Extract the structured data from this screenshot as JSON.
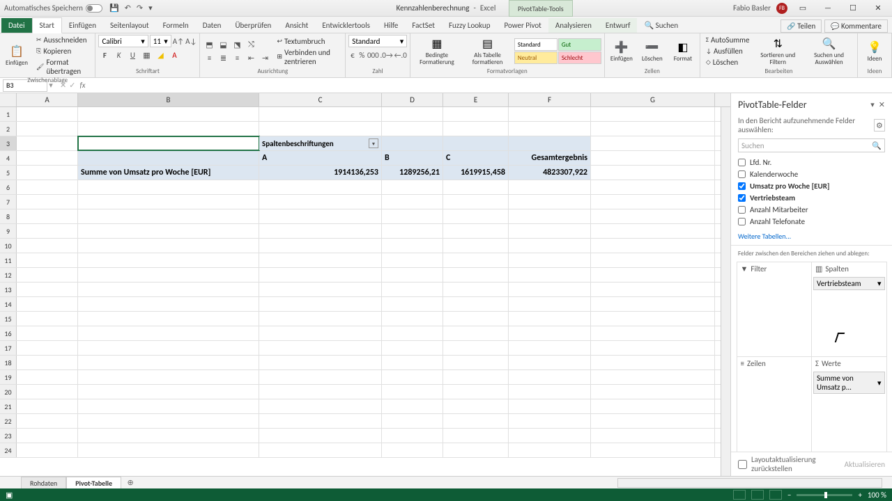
{
  "titlebar": {
    "autosave": "Automatisches Speichern",
    "docname": "Kennzahlenberechnung",
    "appname": "Excel",
    "tooltab": "PivotTable-Tools",
    "user": "Fabio Basler",
    "initials": "FB"
  },
  "tabs": {
    "file": "Datei",
    "start": "Start",
    "einfuegen": "Einfügen",
    "seitenlayout": "Seitenlayout",
    "formeln": "Formeln",
    "daten": "Daten",
    "ueberpruefen": "Überprüfen",
    "ansicht": "Ansicht",
    "entwickler": "Entwicklertools",
    "hilfe": "Hilfe",
    "factset": "FactSet",
    "fuzzy": "Fuzzy Lookup",
    "powerpivot": "Power Pivot",
    "analysieren": "Analysieren",
    "entwurf": "Entwurf",
    "suchen": "Suchen",
    "teilen": "Teilen",
    "kommentare": "Kommentare"
  },
  "ribbon": {
    "clipboard": {
      "paste": "Einfügen",
      "cut": "Ausschneiden",
      "copy": "Kopieren",
      "format": "Format übertragen",
      "label": "Zwischenablage"
    },
    "font": {
      "name": "Calibri",
      "size": "11",
      "label": "Schriftart"
    },
    "align": {
      "wrap": "Textumbruch",
      "merge": "Verbinden und zentrieren",
      "label": "Ausrichtung"
    },
    "number": {
      "format": "Standard",
      "label": "Zahl"
    },
    "cond": {
      "cond": "Bedingte Formatierung",
      "table": "Als Tabelle formatieren"
    },
    "styles": {
      "std": "Standard",
      "gut": "Gut",
      "neu": "Neutral",
      "sch": "Schlecht",
      "label": "Formatvorlagen"
    },
    "cells": {
      "insert": "Einfügen",
      "delete": "Löschen",
      "format": "Format",
      "label": "Zellen"
    },
    "editing": {
      "sum": "AutoSumme",
      "fill": "Ausfüllen",
      "clear": "Löschen",
      "sort": "Sortieren und Filtern",
      "find": "Suchen und Auswählen",
      "label": "Bearbeiten"
    },
    "ideas": {
      "btn": "Ideen",
      "label": "Ideen"
    }
  },
  "fbar": {
    "cell": "B3"
  },
  "cols": {
    "A": "A",
    "B": "B",
    "C": "C",
    "D": "D",
    "E": "E",
    "F": "F",
    "G": "G"
  },
  "table": {
    "c3": "Spaltenbeschriftungen",
    "r4": {
      "c": "A",
      "d": "B",
      "e": "C",
      "f": "Gesamtergebnis"
    },
    "r5": {
      "b": "Summe von Umsatz pro Woche [EUR]",
      "c": "1914136,253",
      "d": "1289256,21",
      "e": "1619915,458",
      "f": "4823307,922"
    }
  },
  "pane": {
    "title": "PivotTable-Felder",
    "sub": "In den Bericht aufzunehmende Felder auswählen:",
    "search": "Suchen",
    "fields": {
      "lfd": "Lfd. Nr.",
      "kw": "Kalenderwoche",
      "umsatz": "Umsatz pro Woche [EUR]",
      "team": "Vertriebsteam",
      "mitarb": "Anzahl Mitarbeiter",
      "tel": "Anzahl Telefonate"
    },
    "more": "Weitere Tabellen...",
    "areas_hdr": "Felder zwischen den Bereichen ziehen und ablegen:",
    "filter": "Filter",
    "spalten": "Spalten",
    "zeilen": "Zeilen",
    "werte": "Werte",
    "spalten_item": "Vertriebsteam",
    "werte_item": "Summe von Umsatz p...",
    "defer": "Layoutaktualisierung zurückstellen",
    "update": "Aktualisieren"
  },
  "sheets": {
    "s1": "Rohdaten",
    "s2": "Pivot-Tabelle"
  },
  "status": {
    "zoom": "100 %"
  }
}
